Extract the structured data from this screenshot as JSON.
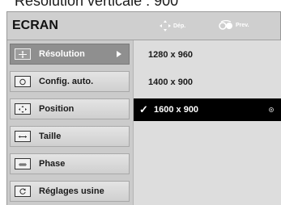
{
  "caption": "Résolution verticale : 900",
  "osd": {
    "title": "ECRAN",
    "hints": {
      "move_label": "Dép.",
      "prev_label": "Prev."
    }
  },
  "menu": {
    "items": [
      {
        "label": "Résolution",
        "icon": "resolution-icon",
        "active": true
      },
      {
        "label": "Config. auto.",
        "icon": "auto-config-icon",
        "active": false
      },
      {
        "label": "Position",
        "icon": "position-icon",
        "active": false
      },
      {
        "label": "Taille",
        "icon": "size-icon",
        "active": false
      },
      {
        "label": "Phase",
        "icon": "phase-icon",
        "active": false
      },
      {
        "label": "Réglages usine",
        "icon": "factory-reset-icon",
        "active": false
      }
    ]
  },
  "options": {
    "items": [
      {
        "label": "1280 x 960",
        "selected": false
      },
      {
        "label": "1400 x 900",
        "selected": false
      },
      {
        "label": "1600 x 900",
        "selected": true
      }
    ],
    "check_mark": "✓"
  }
}
